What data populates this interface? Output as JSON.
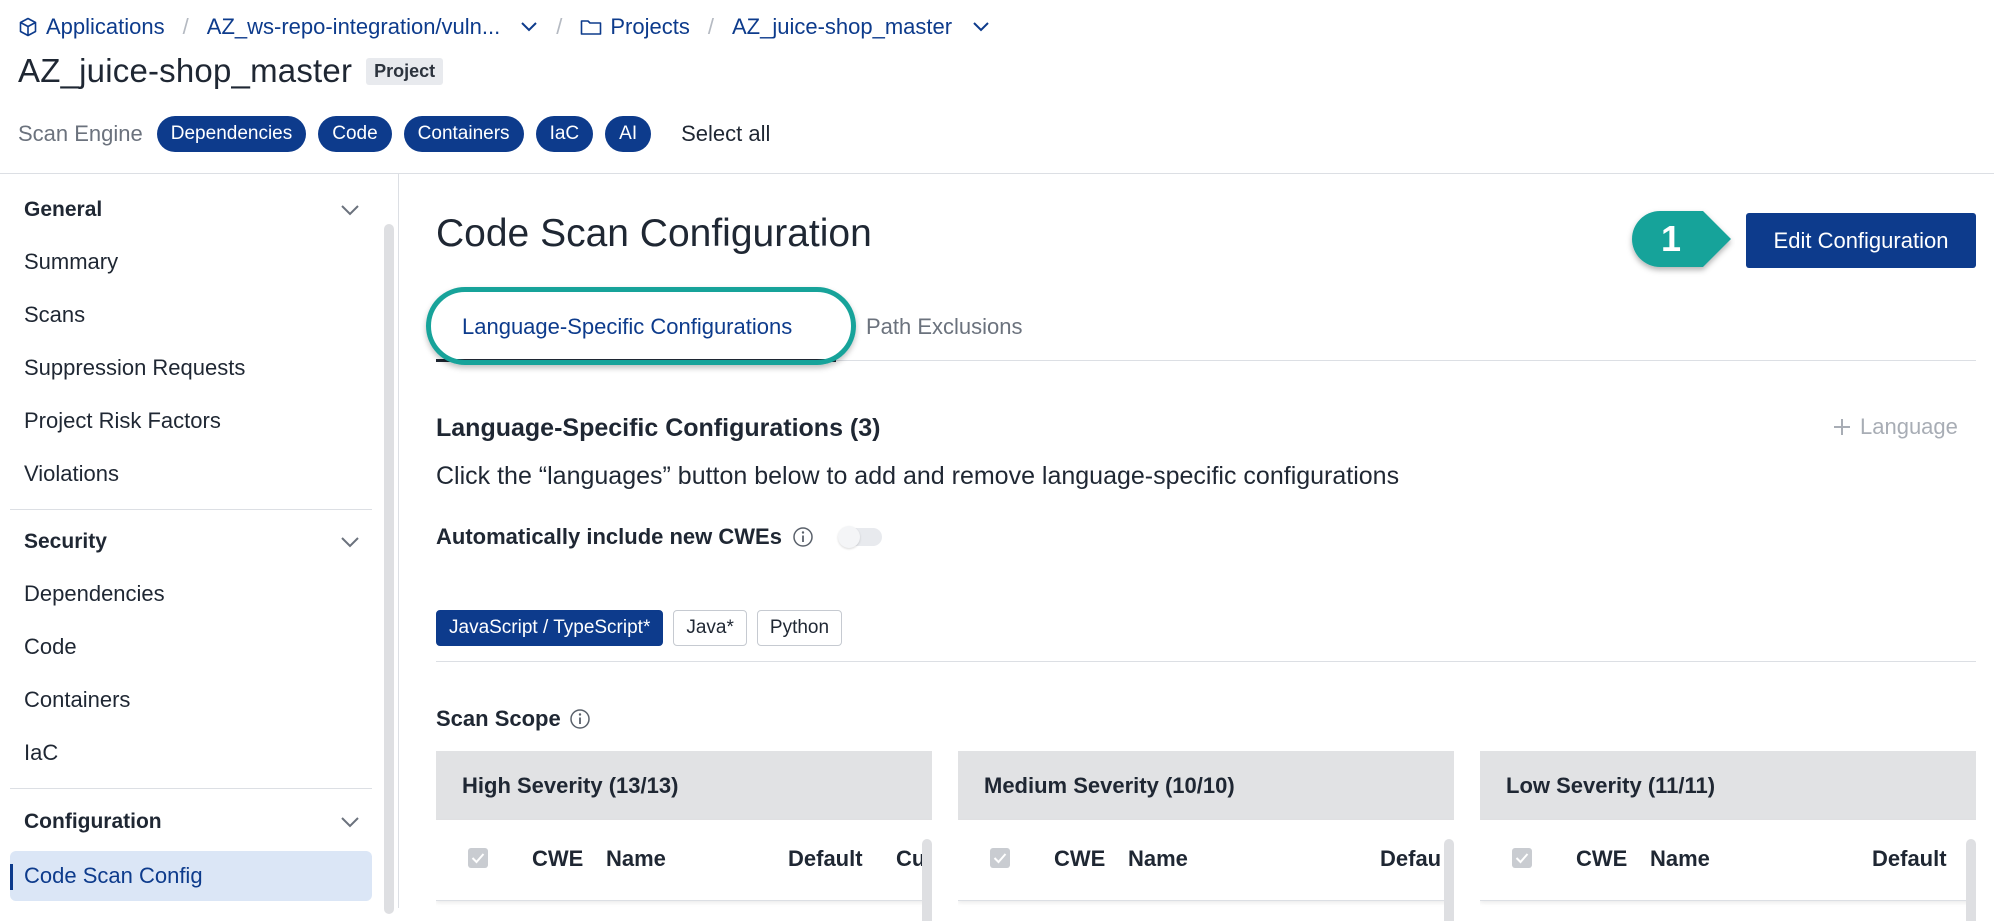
{
  "breadcrumb": {
    "applications": "Applications",
    "app": "AZ_ws-repo-integration/vuln...",
    "projects": "Projects",
    "project": "AZ_juice-shop_master"
  },
  "header": {
    "title": "AZ_juice-shop_master",
    "badge": "Project",
    "scan_engine_label": "Scan Engine",
    "engines": [
      "Dependencies",
      "Code",
      "Containers",
      "IaC",
      "AI"
    ],
    "select_all": "Select all"
  },
  "sidebar": {
    "general": {
      "label": "General",
      "items": [
        "Summary",
        "Scans",
        "Suppression Requests",
        "Project Risk Factors",
        "Violations"
      ]
    },
    "security": {
      "label": "Security",
      "items": [
        "Dependencies",
        "Code",
        "Containers",
        "IaC"
      ]
    },
    "configuration": {
      "label": "Configuration",
      "items": [
        "Code Scan Config"
      ]
    }
  },
  "main": {
    "title": "Code Scan Configuration",
    "edit_button": "Edit Configuration",
    "callout_number": "1",
    "tabs": [
      "Language-Specific Configurations",
      "Path Exclusions"
    ],
    "section_title": "Language-Specific Configurations (3)",
    "add_language": "Language",
    "helper_text": "Click the “languages” button below to add and remove language-specific configurations",
    "auto_cwe_label": "Automatically include new CWEs",
    "auto_cwe_enabled": false,
    "languages": [
      "JavaScript / TypeScript*",
      "Java*",
      "Python"
    ],
    "active_language": "JavaScript / TypeScript*",
    "scan_scope_label": "Scan Scope",
    "severity_cards": [
      {
        "title": "High Severity (13/13)",
        "cols": [
          "CWE",
          "Name",
          "Default",
          "Cu"
        ]
      },
      {
        "title": "Medium Severity (10/10)",
        "cols": [
          "CWE",
          "Name",
          "Defau"
        ]
      },
      {
        "title": "Low Severity (11/11)",
        "cols": [
          "CWE",
          "Name",
          "Default"
        ]
      }
    ]
  },
  "colors": {
    "brand": "#0d3b8c",
    "callout": "#17a39a",
    "active_nav": "#dbe6f6"
  }
}
